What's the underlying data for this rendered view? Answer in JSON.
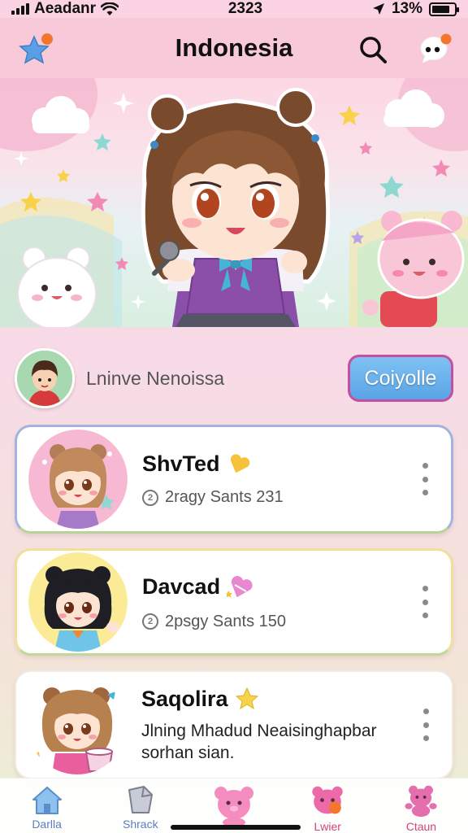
{
  "status_bar": {
    "carrier": "Aeadanr",
    "time": "2323",
    "battery": "13%"
  },
  "header": {
    "title": "Indonesia"
  },
  "profile": {
    "name": "Lninve Nenoissa",
    "follow_label": "Coiyolle"
  },
  "cards": [
    {
      "name": "ShvTed",
      "sub": "2ragy  Sants 231",
      "badge": "heart-icon"
    },
    {
      "name": "Davcad",
      "sub": "2psgy  Sants 150",
      "badge": "heart-icon"
    },
    {
      "name": "Saqolira",
      "desc_line1": "Jlning Mhadud Neaisinghapbar",
      "desc_line2": "sorhan sian.",
      "badge": "star-icon"
    }
  ],
  "bottom_nav": [
    {
      "label": "Darlla",
      "icon": "home-icon"
    },
    {
      "label": "Shrack",
      "icon": "share-icon"
    },
    {
      "label": "",
      "icon": "bear-icon"
    },
    {
      "label": "Lwier",
      "icon": "bear-face-icon"
    },
    {
      "label": "Ctaun",
      "icon": "bear-pose-icon"
    }
  ],
  "colors": {
    "accent_pink": "#f8c9d8",
    "follow_button": "#5aa4e6",
    "follow_border": "#c64fa1",
    "nav_blue": "#5a7fc0",
    "nav_pink": "#d2437d"
  }
}
